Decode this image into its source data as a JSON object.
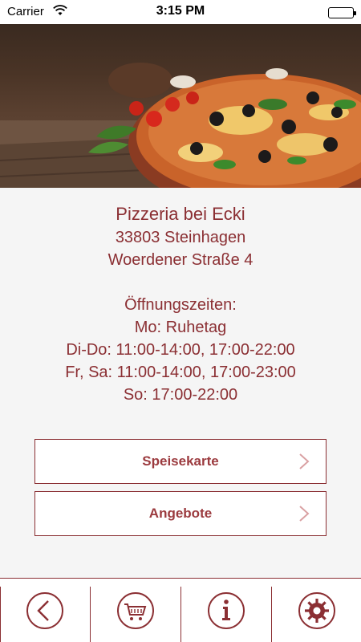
{
  "status_bar": {
    "carrier": "Carrier",
    "time": "3:15 PM",
    "icons": [
      "wifi-icon",
      "battery-icon"
    ]
  },
  "hero": {
    "image": "pizza-photo"
  },
  "restaurant": {
    "name": "Pizzeria bei Ecki",
    "city": "33803 Steinhagen",
    "street": "Woerdener Straße 4"
  },
  "hours": {
    "title": "Öffnungszeiten:",
    "lines": [
      "Mo: Ruhetag",
      "Di-Do: 11:00-14:00, 17:00-22:00",
      "Fr, Sa: 11:00-14:00, 17:00-23:00",
      "So: 17:00-22:00"
    ]
  },
  "buttons": {
    "menu_label": "Speisekarte",
    "offers_label": "Angebote"
  },
  "tabbar": {
    "items": [
      "back-icon",
      "cart-icon",
      "info-icon",
      "settings-icon"
    ]
  },
  "colors": {
    "accent": "#8b2f33",
    "background": "#f5f5f5"
  }
}
